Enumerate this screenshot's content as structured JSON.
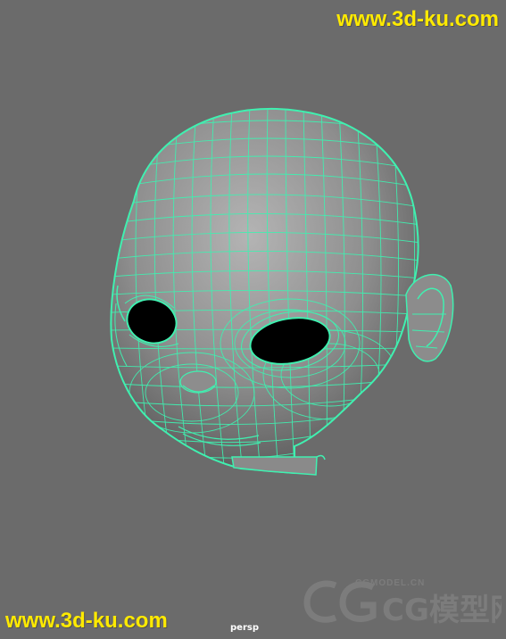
{
  "viewport": {
    "camera_label": "persp",
    "background_color": "#6b6b6b",
    "wire_color": "#40f0b0",
    "mesh_color": "#9a9a9a"
  },
  "watermarks": {
    "top_right": "www.3d-ku.com",
    "bottom_left": "www.3d-ku.com",
    "logo_small_text": "CGMODEL.CN",
    "logo_main_text": "CG模型网",
    "text_color": "#ffea00"
  },
  "model": {
    "object": "cartoon head wireframe",
    "icon": "wireframe-head-icon"
  }
}
